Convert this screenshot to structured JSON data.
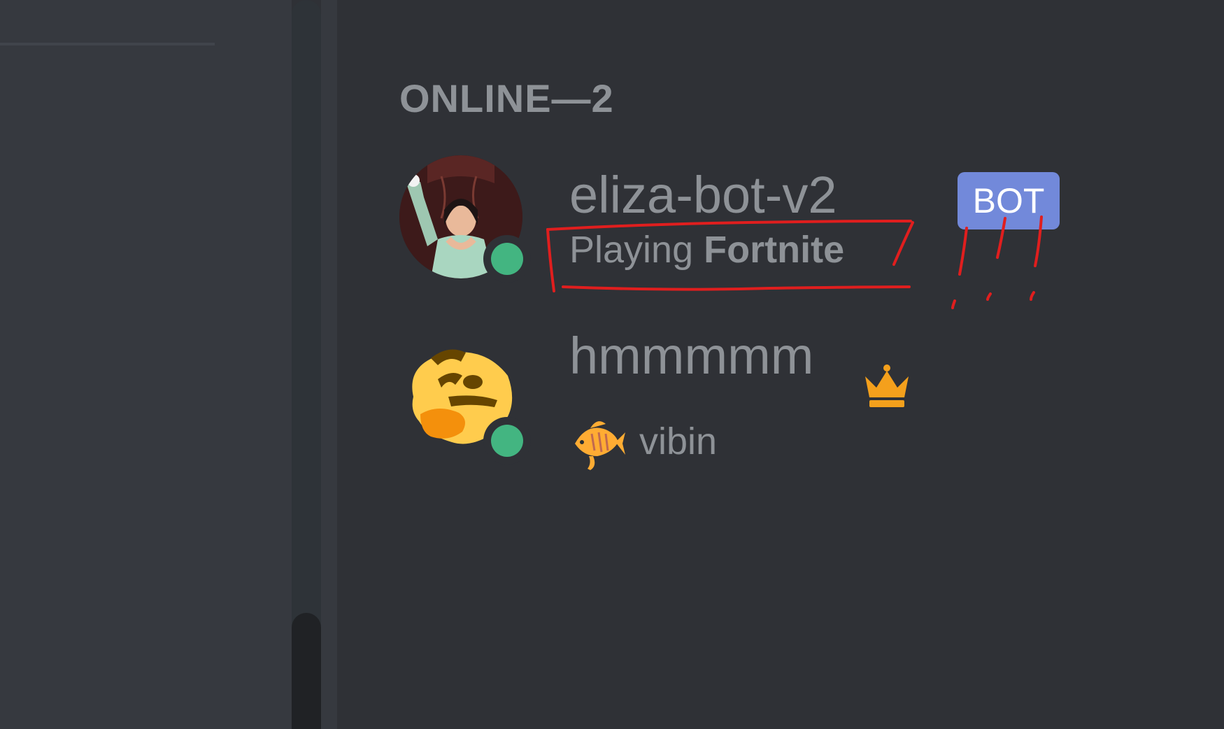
{
  "members_list": {
    "section_header": "ONLINE—2",
    "members": [
      {
        "name": "eliza-bot-v2",
        "tag": "BOT",
        "activity_prefix": "Playing",
        "activity_name": "Fortnite",
        "status": "online",
        "avatar_icon": "avatar-photo-icon",
        "status_color": "#43b581"
      },
      {
        "name": "hmmmmm",
        "owner_icon": "crown-icon",
        "custom_status_emoji": "tropical-fish-icon",
        "custom_status_text": "vibin",
        "status": "online",
        "avatar_icon": "thinking-face-icon",
        "status_color": "#43b581"
      }
    ]
  },
  "colors": {
    "background": "#2f3136",
    "left_pane": "#36393f",
    "muted_text": "#8e9297",
    "bot_tag": "#7289da",
    "online": "#43b581",
    "annotation": "#e01e1e"
  }
}
